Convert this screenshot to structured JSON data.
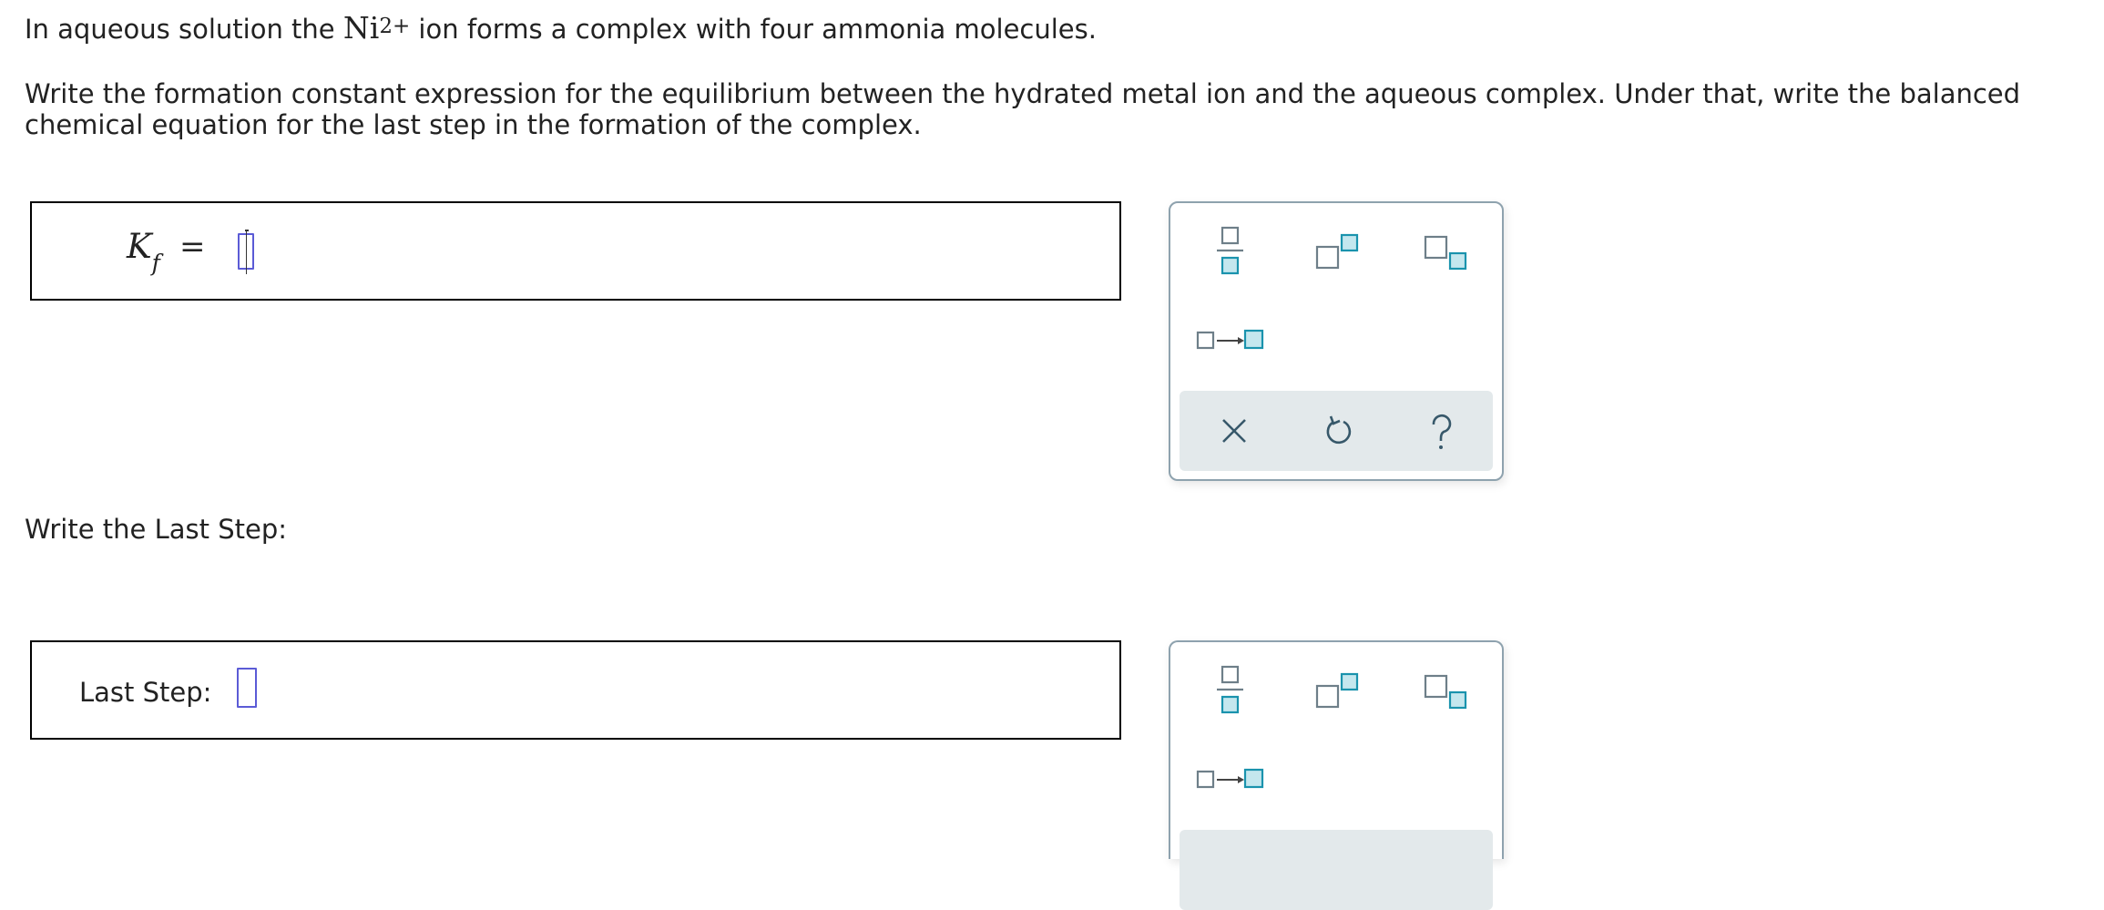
{
  "question": {
    "intro_before": "In aqueous solution the ",
    "ion_symbol": "Ni",
    "ion_charge": "2+",
    "intro_after": " ion forms a complex with four ammonia molecules.",
    "instruction": "Write the formation constant expression for the equilibrium between the hydrated metal ion and the aqueous complex. Under that, write the balanced chemical equation for the last step in the formation of the complex.",
    "last_step_prompt": "Write the Last Step:"
  },
  "answer1": {
    "kf_symbol": "K",
    "kf_subscript": "f",
    "equals": "="
  },
  "answer2": {
    "label": "Last Step:"
  },
  "palette": {
    "tools": [
      "fraction-icon",
      "superscript-icon",
      "subscript-icon",
      "reaction-arrow-icon"
    ],
    "controls": [
      "clear-icon",
      "undo-icon",
      "help-icon"
    ]
  },
  "colors": {
    "icon_gray": "#6e7f89",
    "icon_teal": "#1a93ad",
    "icon_teal_fill": "#c4e7ee",
    "control_bar": "#e3e9eb",
    "cursor": "#5b5bd6",
    "palette_border": "#8ea2ae"
  }
}
